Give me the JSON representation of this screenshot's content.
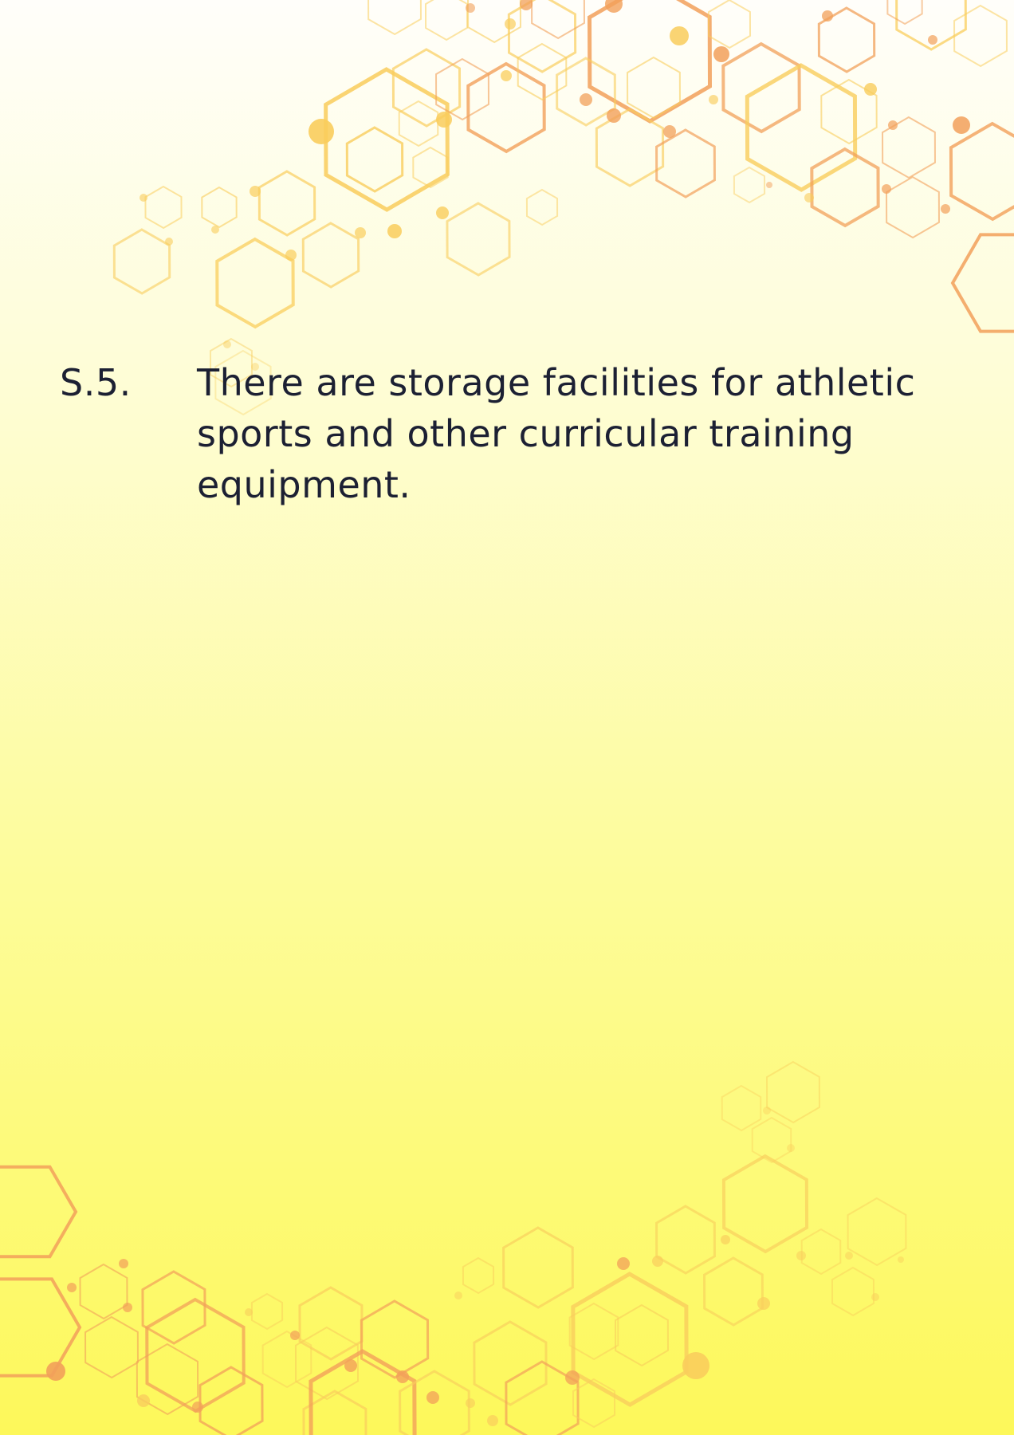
{
  "section": {
    "number": "S.5.",
    "text": "There are storage facilities for athletic sports and other curricular training equipment."
  },
  "colors": {
    "text": "#1c2033",
    "hex_light": "#f9cd5c",
    "hex_dark": "#f2a05a",
    "background_top": "#fffefa",
    "background_bottom": "#fdf85a"
  },
  "decoration": {
    "top_pattern": "hexagon-network",
    "bottom_pattern": "hexagon-network"
  }
}
